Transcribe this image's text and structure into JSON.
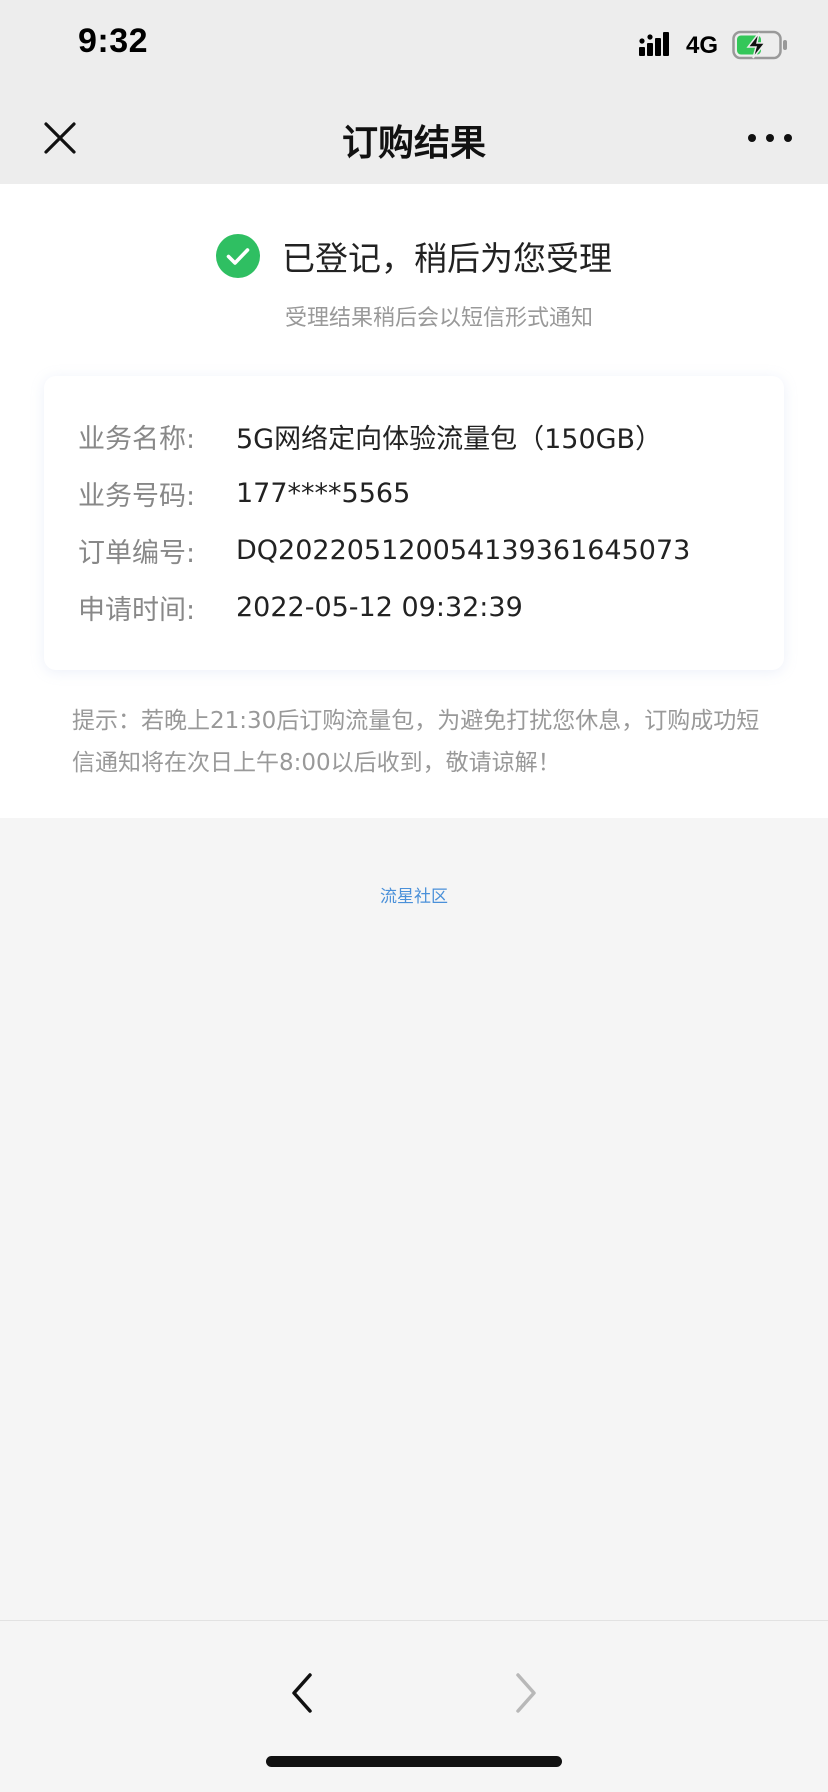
{
  "status_bar": {
    "time": "9:32",
    "network": "4G",
    "icons": [
      "signal-icon",
      "battery-charging-icon"
    ]
  },
  "nav": {
    "title": "订购结果",
    "icons": [
      "close-icon",
      "more-icon"
    ]
  },
  "result": {
    "title": "已登记，稍后为您受理",
    "subtitle": "受理结果稍后会以短信形式通知",
    "icon": "check-circle-icon",
    "accent_color": "#2fbf62"
  },
  "info": {
    "rows": [
      {
        "label": "业务名称:",
        "value": "5G网络定向体验流量包（150GB）"
      },
      {
        "label": "业务号码:",
        "value": "177****5565"
      },
      {
        "label": "订单编号:",
        "value": "DQ2022051200541393616450​73"
      },
      {
        "label": "申请时间:",
        "value": "2022-05-12 09:32:39"
      }
    ]
  },
  "tip": "提示：若晚上21:30后订购流量包，为避免打扰您休息，订购成功短信通知将在次日上午8:00以后收到，敬请谅解！",
  "footer": {
    "link": "流星社区",
    "link_color": "#4a90d9"
  },
  "bottom_nav": {
    "icons": [
      "back-arrow-icon",
      "forward-arrow-icon"
    ]
  }
}
